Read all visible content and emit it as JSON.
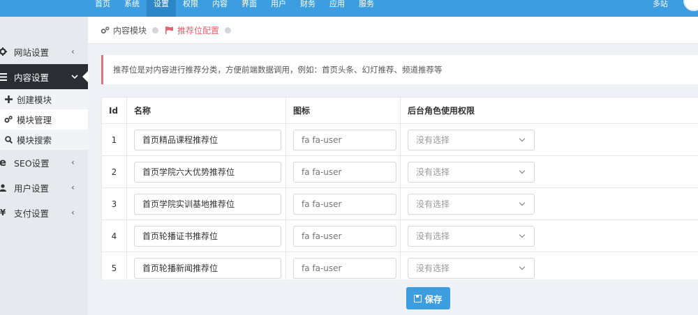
{
  "topnav": {
    "items": [
      "首页",
      "系统",
      "设置",
      "权限",
      "内容",
      "界面",
      "用户",
      "财务",
      "应用",
      "服务"
    ],
    "active_index": 2,
    "right_label": "多站"
  },
  "sidebar": {
    "items": [
      {
        "label": "网站设置",
        "icon": "gear-icon"
      },
      {
        "label": "内容设置",
        "icon": "bars-icon"
      },
      {
        "label": "SEO设置",
        "icon": "ie-icon"
      },
      {
        "label": "用户设置",
        "icon": "user-icon"
      },
      {
        "label": "支付设置",
        "icon": "yen-icon"
      }
    ],
    "sub_items": [
      {
        "label": "创建模块",
        "icon": "plus-icon"
      },
      {
        "label": "模块管理",
        "icon": "cogs-icon"
      },
      {
        "label": "模块搜索",
        "icon": "search-icon"
      }
    ]
  },
  "breadcrumb": {
    "items": [
      {
        "label": "内容模块",
        "icon": "cogs-icon"
      },
      {
        "label": "推荐位配置",
        "icon": "flag-icon"
      }
    ]
  },
  "alert": {
    "text": "推荐位是对内容进行推荐分类，方便前端数据调用，例如：首页头条、幻灯推荐、频道推荐等"
  },
  "table": {
    "headers": [
      "Id",
      "名称",
      "图标",
      "后台角色使用权限"
    ],
    "rows": [
      {
        "id": "1",
        "name": "首页精品课程推荐位",
        "icon_placeholder": "fa fa-user",
        "role": "没有选择"
      },
      {
        "id": "2",
        "name": "首页学院六大优势推荐位",
        "icon_placeholder": "fa fa-user",
        "role": "没有选择"
      },
      {
        "id": "3",
        "name": "首页学院实训基地推荐位",
        "icon_placeholder": "fa fa-user",
        "role": "没有选择"
      },
      {
        "id": "4",
        "name": "首页轮播证书推荐位",
        "icon_placeholder": "fa fa-user",
        "role": "没有选择"
      },
      {
        "id": "5",
        "name": "首页轮播新闻推荐位",
        "icon_placeholder": "fa fa-user",
        "role": "没有选择"
      }
    ]
  },
  "actions": {
    "save_label": "保存"
  },
  "colors": {
    "primary": "#3c9ee0",
    "accent": "#e0656e",
    "sidebar_active": "#2a2e34"
  }
}
